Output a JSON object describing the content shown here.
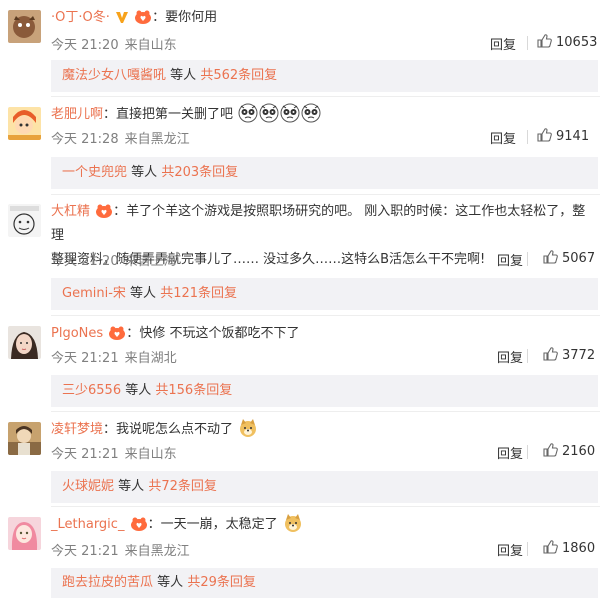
{
  "common": {
    "reply_label": "回复",
    "etc_label": "等人"
  },
  "comments": [
    {
      "user": "·O丁·O冬·",
      "text": "要你何用",
      "time": "今天 21:20",
      "location": "来自山东",
      "likes": "10653",
      "sub": {
        "name": "魔法少女八嘎酱吼",
        "count": "共562条回复"
      }
    },
    {
      "user": "老肥儿啊",
      "text": "直接把第一关删了吧",
      "time": "今天 21:28",
      "location": "来自黑龙江",
      "likes": "9141",
      "sub": {
        "name": "一个史兜兜",
        "count": "共203条回复"
      }
    },
    {
      "user": "大杠精",
      "text": "羊了个羊这个游戏是按照职场研究的吧。 刚入职的时候：这工作也太轻松了，整理",
      "text2": "整理资料，随便弄弄就完事儿了…… 没过多久……这特么B活怎么干不完啊!",
      "time": "今天 21:20",
      "location": "来自上海",
      "likes": "5067",
      "sub": {
        "name": "Gemini-宋",
        "count": "共121条回复"
      }
    },
    {
      "user": "PlgoNes",
      "text": "快修 不玩这个饭都吃不下了",
      "time": "今天 21:21",
      "location": "来自湖北",
      "likes": "3772",
      "sub": {
        "name": "三少6556",
        "count": "共156条回复"
      }
    },
    {
      "user": "凌轩梦境",
      "text": "我说呢怎么点不动了",
      "time": "今天 21:21",
      "location": "来自山东",
      "likes": "2160",
      "sub": {
        "name": "火球妮妮",
        "count": "共72条回复"
      }
    },
    {
      "user": "_Lethargic_",
      "text": "一天一崩，太稳定了",
      "time": "今天 21:21",
      "location": "来自黑龙江",
      "likes": "1860",
      "sub": {
        "name": "跑去拉皮的苦瓜",
        "count": "共29条回复"
      }
    }
  ],
  "colors": {
    "username": "#eb7350",
    "meta": "#808080",
    "subreply_bg": "#f2f2f5"
  }
}
